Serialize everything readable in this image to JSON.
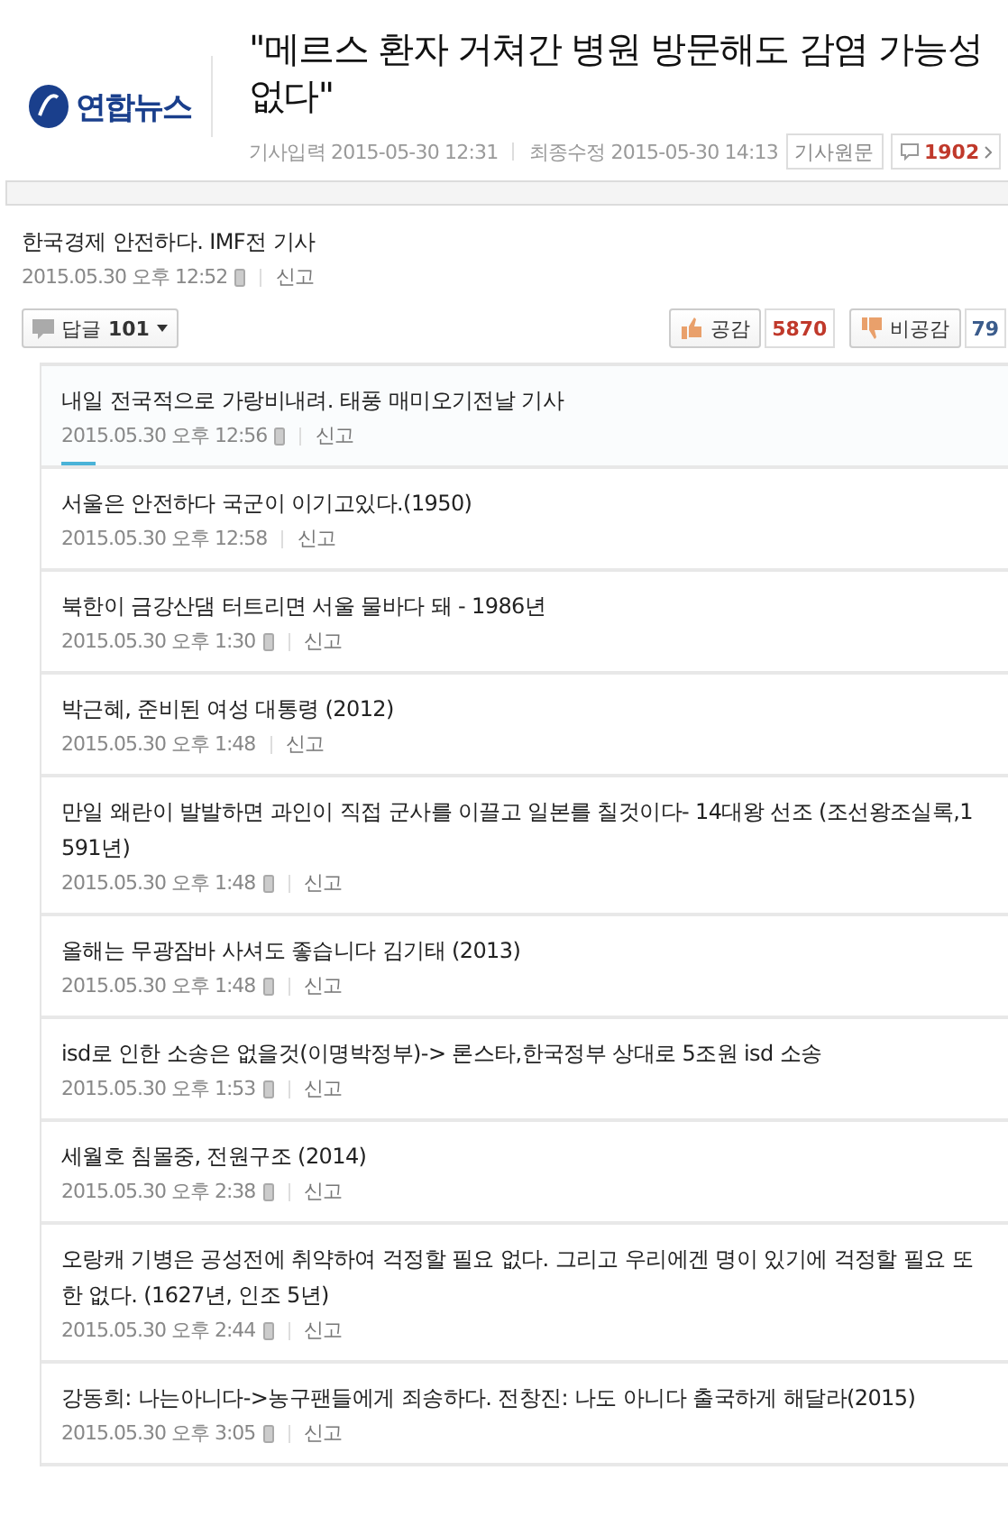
{
  "header": {
    "logo": "연합뉴스",
    "title": "\"메르스 환자 거쳐간 병원 방문해도 감염 가능성\n없다\"",
    "meta": [
      {
        "label": "기사입력",
        "value": "2015-05-30 12:31"
      },
      {
        "label": "최종수정",
        "value": "2015-05-30 14:13"
      }
    ],
    "original_button": "기사원문",
    "comment_count": "1902"
  },
  "comment": {
    "text": "한국경제 안전하다. IMF전 기사",
    "date": "2015.05.30 오후 12:52",
    "mobile": true,
    "report": "신고",
    "reply_label": "답글",
    "reply_count": "101",
    "like_label": "공감",
    "like_count": "5870",
    "dislike_label": "비공감",
    "dislike_count": "79"
  },
  "replies": [
    {
      "text": "내일 전국적으로 가랑비내려. 태풍 매미오기전날 기사",
      "date": "2015.05.30 오후 12:56",
      "mobile": true,
      "report": "신고",
      "selected": true
    },
    {
      "text": "서울은 안전하다 국군이 이기고있다.(1950)",
      "date": "2015.05.30 오후 12:58",
      "mobile": false,
      "report": "신고",
      "selected": false
    },
    {
      "text": "북한이 금강산댐 터트리면 서울 물바다 돼 - 1986년",
      "date": "2015.05.30 오후 1:30",
      "mobile": true,
      "report": "신고",
      "selected": false
    },
    {
      "text": "박근혜, 준비된 여성 대통령 (2012)",
      "date": "2015.05.30 오후 1:48",
      "mobile": false,
      "report": "신고",
      "selected": false
    },
    {
      "text": "만일 왜란이 발발하면 과인이 직접 군사를 이끌고 일본를 칠것이다- 14대왕 선조 (조선왕조실록,1\n591년)",
      "date": "2015.05.30 오후 1:48",
      "mobile": true,
      "report": "신고",
      "selected": false
    },
    {
      "text": "올해는 무광잠바 사셔도 좋습니다 김기태 (2013)",
      "date": "2015.05.30 오후 1:48",
      "mobile": true,
      "report": "신고",
      "selected": false
    },
    {
      "text": "isd로 인한 소송은 없을것(이명박정부)-> 론스타,한국정부 상대로 5조원 isd 소송",
      "date": "2015.05.30 오후 1:53",
      "mobile": true,
      "report": "신고",
      "selected": false
    },
    {
      "text": "세월호 침몰중, 전원구조 (2014)",
      "date": "2015.05.30 오후 2:38",
      "mobile": true,
      "report": "신고",
      "selected": false
    },
    {
      "text": "오랑캐 기병은 공성전에 취약하여 걱정할 필요 없다. 그리고 우리에겐 명이 있기에 걱정할 필요 또\n한 없다. (1627년, 인조 5년)",
      "date": "2015.05.30 오후 2:44",
      "mobile": true,
      "report": "신고",
      "selected": false
    },
    {
      "text": "강동희: 나는아니다->농구팬들에게 죄송하다. 전창진: 나도 아니다 출국하게 해달라(2015)",
      "date": "2015.05.30 오후 3:05",
      "mobile": true,
      "report": "신고",
      "selected": false
    }
  ]
}
